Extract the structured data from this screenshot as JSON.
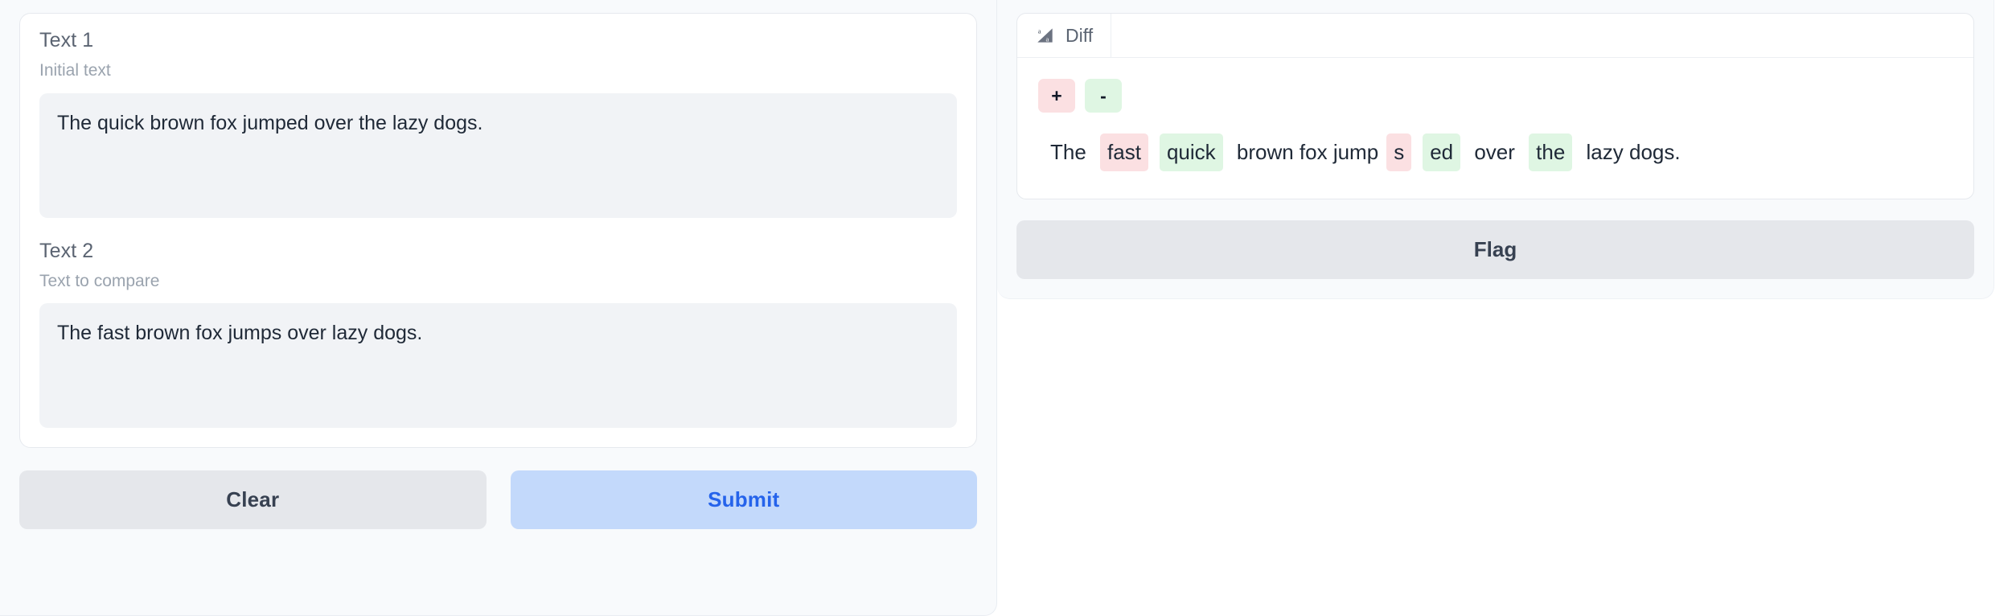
{
  "left_panel": {
    "fields": [
      {
        "label": "Text 1",
        "info": "Initial text",
        "value": "The quick brown fox jumped over the lazy dogs.",
        "placeholder": ""
      },
      {
        "label": "Text 2",
        "info": "Text to compare",
        "value": "The fast brown fox jumps over lazy dogs.",
        "placeholder": ""
      }
    ],
    "buttons": {
      "clear_label": "Clear",
      "submit_label": "Submit"
    }
  },
  "right_panel": {
    "tab": {
      "label": "Diff",
      "icon": "text-diff-icon"
    },
    "legend": [
      {
        "symbol": "+",
        "kind": "insert",
        "color": "#fbe0e2"
      },
      {
        "symbol": "-",
        "kind": "delete",
        "color": "#dff6e3"
      }
    ],
    "diff_tokens": [
      {
        "text": "The ",
        "kind": "equal"
      },
      {
        "text": "fast",
        "kind": "insert"
      },
      {
        "text": "quick",
        "kind": "delete"
      },
      {
        "text": " brown fox jump",
        "kind": "equal"
      },
      {
        "text": "s",
        "kind": "insert"
      },
      {
        "text": "ed",
        "kind": "delete"
      },
      {
        "text": " over ",
        "kind": "equal"
      },
      {
        "text": "the",
        "kind": "delete"
      },
      {
        "text": " lazy dogs.",
        "kind": "equal"
      }
    ],
    "flag_label": "Flag"
  },
  "colors": {
    "insert_bg": "#fbe0e2",
    "delete_bg": "#dff6e3",
    "submit_bg": "#c3d9fb",
    "submit_fg": "#2563eb",
    "neutral_btn_bg": "#e5e7eb",
    "panel_bg": "#f8fafc",
    "field_bg": "#f1f3f6"
  }
}
